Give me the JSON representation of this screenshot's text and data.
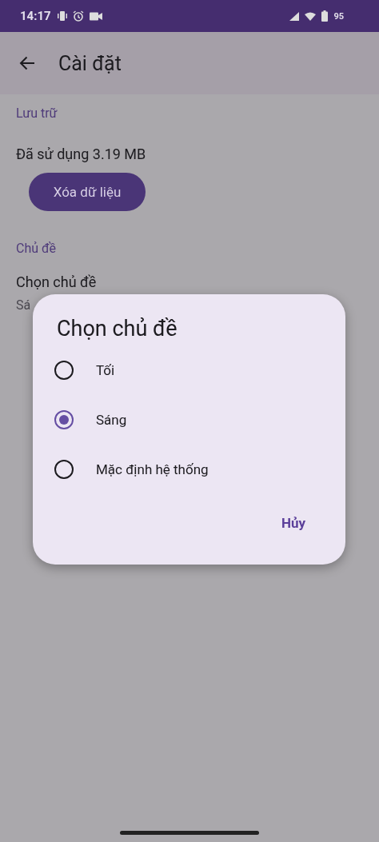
{
  "status_bar": {
    "time": "14:17",
    "battery": "95"
  },
  "app_bar": {
    "title": "Cài đặt"
  },
  "sections": [
    {
      "header": "Lưu trữ",
      "text": "Đã sử dụng 3.19 MB",
      "button": "Xóa dữ liệu"
    },
    {
      "header": "Chủ đề",
      "item_title": "Chọn chủ đề",
      "item_subtitle": "Sá"
    }
  ],
  "dialog": {
    "title": "Chọn chủ đề",
    "options": [
      {
        "label": "Tối",
        "selected": false
      },
      {
        "label": "Sáng",
        "selected": true
      },
      {
        "label": "Mặc định hệ thống",
        "selected": false
      }
    ],
    "cancel": "Hủy"
  }
}
